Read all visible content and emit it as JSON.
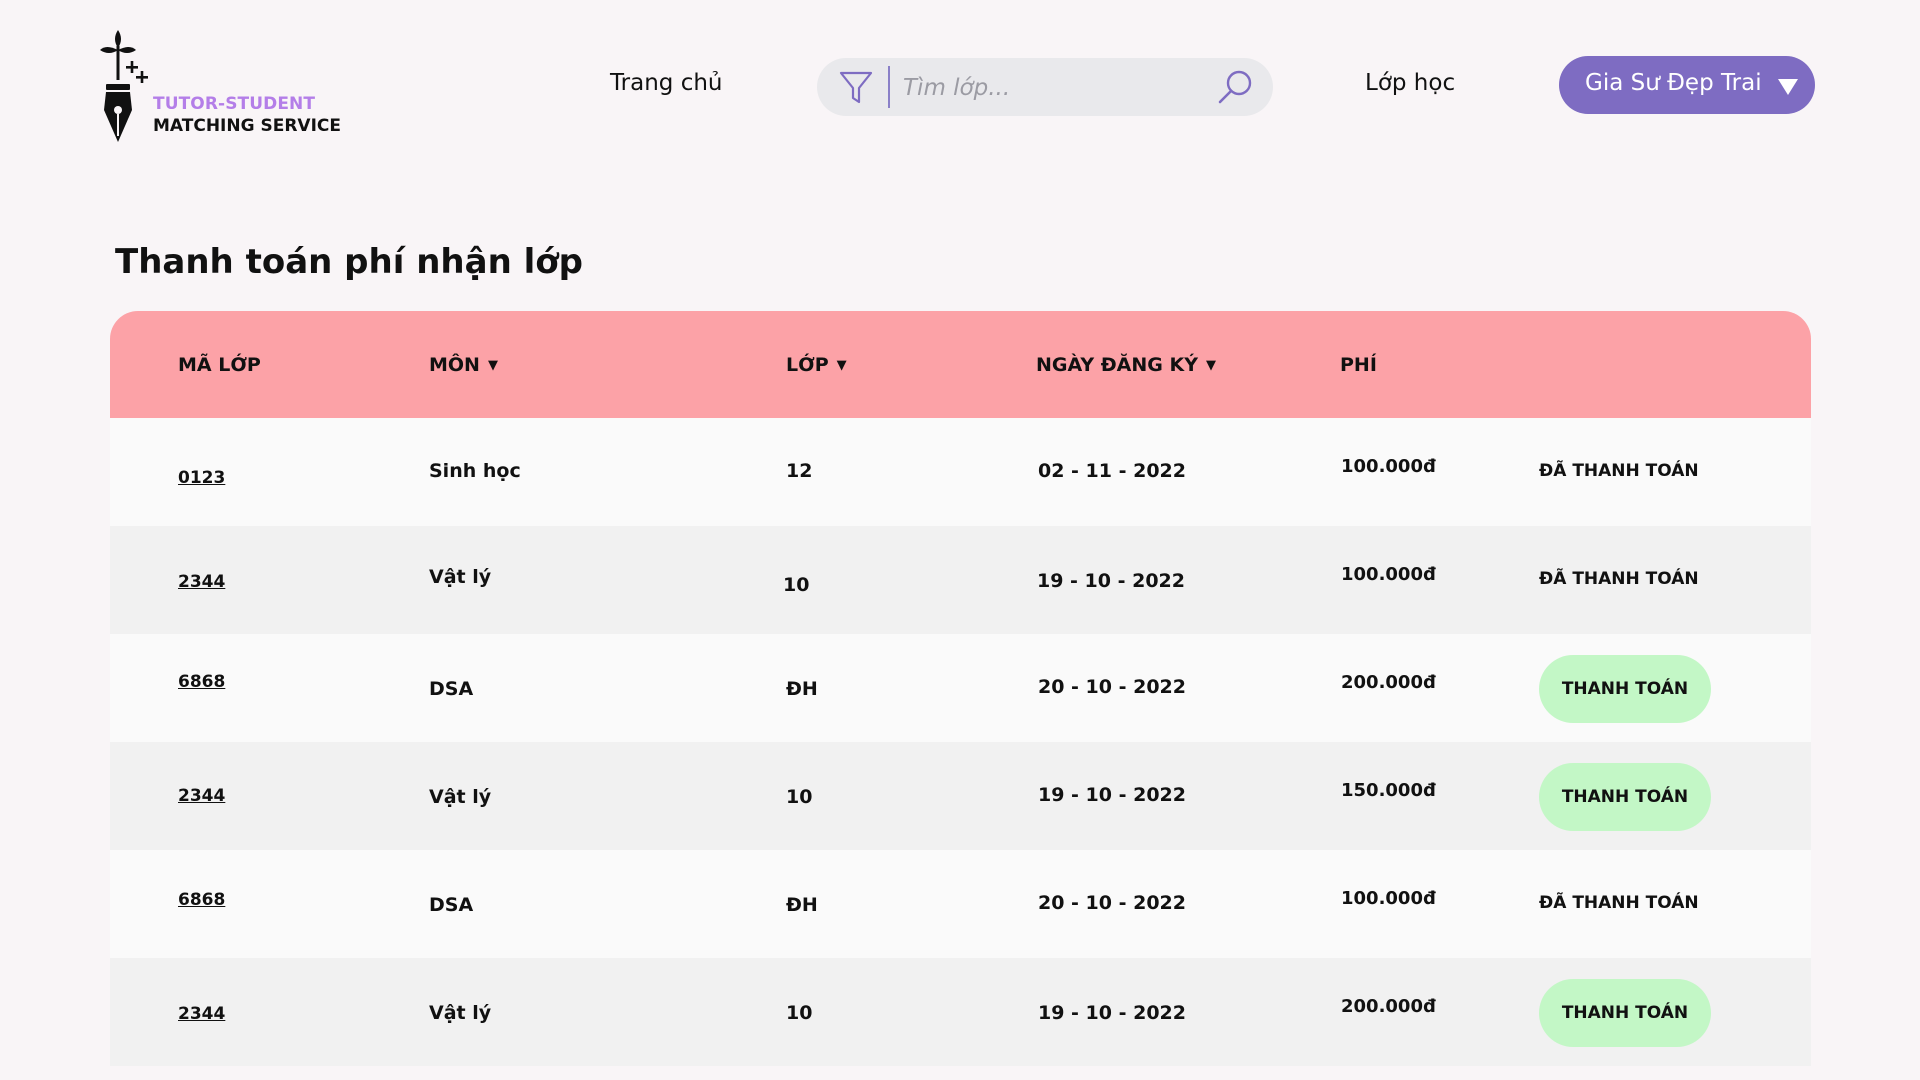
{
  "brand": {
    "line1": "TUTOR-STUDENT",
    "line2": "MATCHING SERVICE",
    "logo_icon": "fountain-pen-plant-icon",
    "accent_color": "#b47ee8"
  },
  "nav": {
    "home": "Trang chủ",
    "classes": "Lớp học"
  },
  "search": {
    "placeholder": "Tìm lớp...",
    "value": "",
    "filter_icon": "filter-icon",
    "search_icon": "search-icon"
  },
  "user": {
    "name": "Gia Sư Đẹp Trai",
    "button_color": "#7e6cc2"
  },
  "page": {
    "title": "Thanh toán phí nhận lớp"
  },
  "table": {
    "header_color": "#fca2a7",
    "columns": {
      "code": "MÃ LỚP",
      "subject": "MÔN",
      "grade": "LỚP",
      "date": "NGÀY ĐĂNG KÝ",
      "fee": "PHÍ"
    },
    "paid_label": "ĐÃ THANH TOÁN",
    "pay_label": "THANH TOÁN",
    "pay_button_color": "#c3f7c6",
    "rows": [
      {
        "code": "0123",
        "subject": "Sinh học",
        "grade": "12",
        "date": "02 - 11 - 2022",
        "fee": "100.000đ",
        "paid": true
      },
      {
        "code": "2344",
        "subject": "Vật lý",
        "grade": "10",
        "date": "19 -  10 - 2022",
        "fee": "100.000đ",
        "paid": true
      },
      {
        "code": "6868",
        "subject": "DSA",
        "grade": "ĐH",
        "date": "20 -  10 - 2022",
        "fee": "200.000đ",
        "paid": false
      },
      {
        "code": "2344",
        "subject": "Vật lý",
        "grade": "10",
        "date": "19 -  10 - 2022",
        "fee": "150.000đ",
        "paid": false
      },
      {
        "code": "6868",
        "subject": "DSA",
        "grade": "ĐH",
        "date": "20 -  10 - 2022",
        "fee": "100.000đ",
        "paid": true
      },
      {
        "code": "2344",
        "subject": "Vật lý",
        "grade": "10",
        "date": "19 -  10 - 2022",
        "fee": "200.000đ",
        "paid": false
      }
    ]
  }
}
